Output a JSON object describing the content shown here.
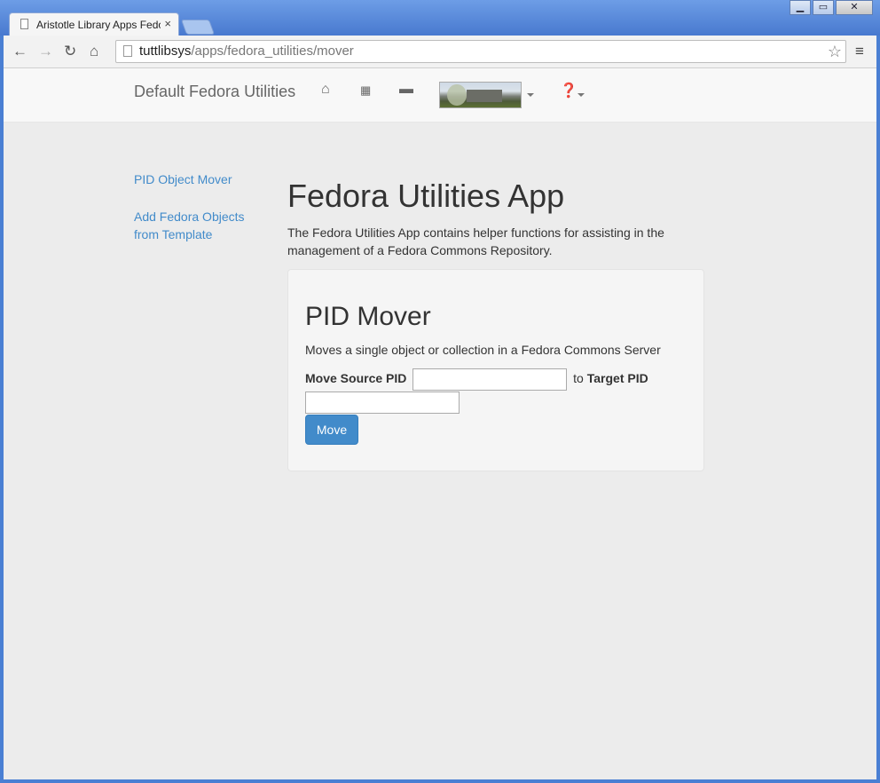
{
  "browser": {
    "tab_title": "Aristotle Library Apps Fedo",
    "tab_close": "×",
    "url_host": "tuttlibsys",
    "url_path": "/apps/fedora_utilities/mover"
  },
  "navbar": {
    "brand": "Default Fedora Utilities",
    "icons": [
      "home-icon",
      "apps-grid-icon",
      "comment-icon",
      "library-photo",
      "help-icon"
    ]
  },
  "sidebar": {
    "items": [
      {
        "label": "PID Object Mover"
      },
      {
        "label": "Add Fedora Objects from Template"
      }
    ]
  },
  "main": {
    "title": "Fedora Utilities App",
    "description": "The Fedora Utilities App contains helper functions for assisting in the management of a Fedora Commons Repository."
  },
  "mover": {
    "title": "PID Mover",
    "description": "Moves a single object or collection in a Fedora Commons Server",
    "source_label": "Move Source PID",
    "to_text": "to",
    "target_label": "Target PID",
    "source_value": "",
    "target_value": "",
    "button_label": "Move"
  },
  "colors": {
    "link": "#428bca",
    "primary_button": "#428bca",
    "page_bg": "#ececec"
  }
}
